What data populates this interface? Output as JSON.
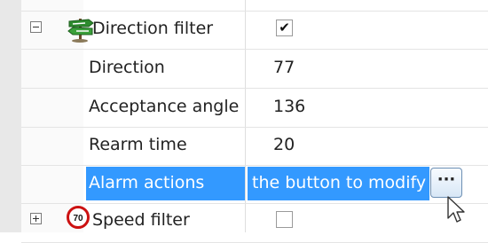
{
  "property_grid": {
    "rows": [
      {
        "name": "Direction filter",
        "value_checked": true,
        "expanded": true,
        "icon": "direction-signpost-icon"
      },
      {
        "name": "Direction",
        "value": "77"
      },
      {
        "name": "Acceptance angle",
        "value": "136"
      },
      {
        "name": "Rearm time",
        "value": "20"
      },
      {
        "name": "Alarm actions",
        "value": "the button to modify",
        "selected": true,
        "button_label": "···"
      },
      {
        "name": "Speed filter",
        "value_checked": false,
        "expanded": false,
        "icon": "speed-limit-sign-icon",
        "sign_text": "70"
      }
    ]
  },
  "colors": {
    "selection": "#3399ff",
    "speed_sign_ring": "#cc1111"
  }
}
